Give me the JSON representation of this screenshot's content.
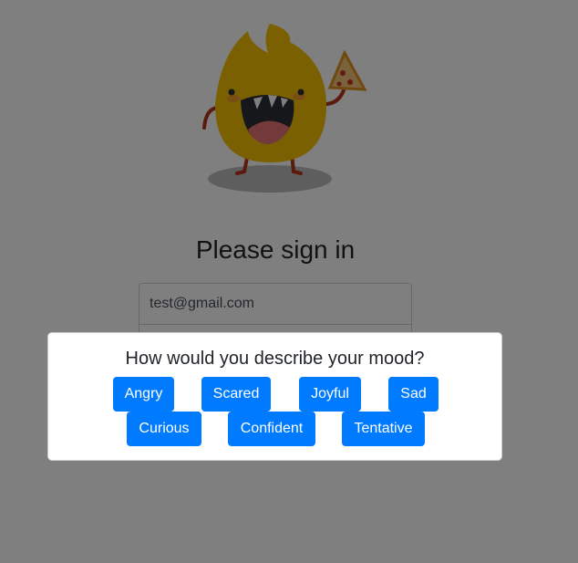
{
  "page": {
    "title": "Please sign in",
    "email_value": "test@gmail.com"
  },
  "mood_modal": {
    "question": "How would you describe your mood?",
    "options": [
      "Angry",
      "Scared",
      "Joyful",
      "Sad",
      "Curious",
      "Confident",
      "Tentative"
    ]
  },
  "colors": {
    "button": "#007bff",
    "overlay": "rgba(0,0,0,0.5)",
    "mascot_body": "#f5c000",
    "mascot_mouth": "#2b2f36",
    "mascot_tongue": "#e57575"
  },
  "icons": {
    "mascot": "fire-mascot-with-pizza"
  }
}
